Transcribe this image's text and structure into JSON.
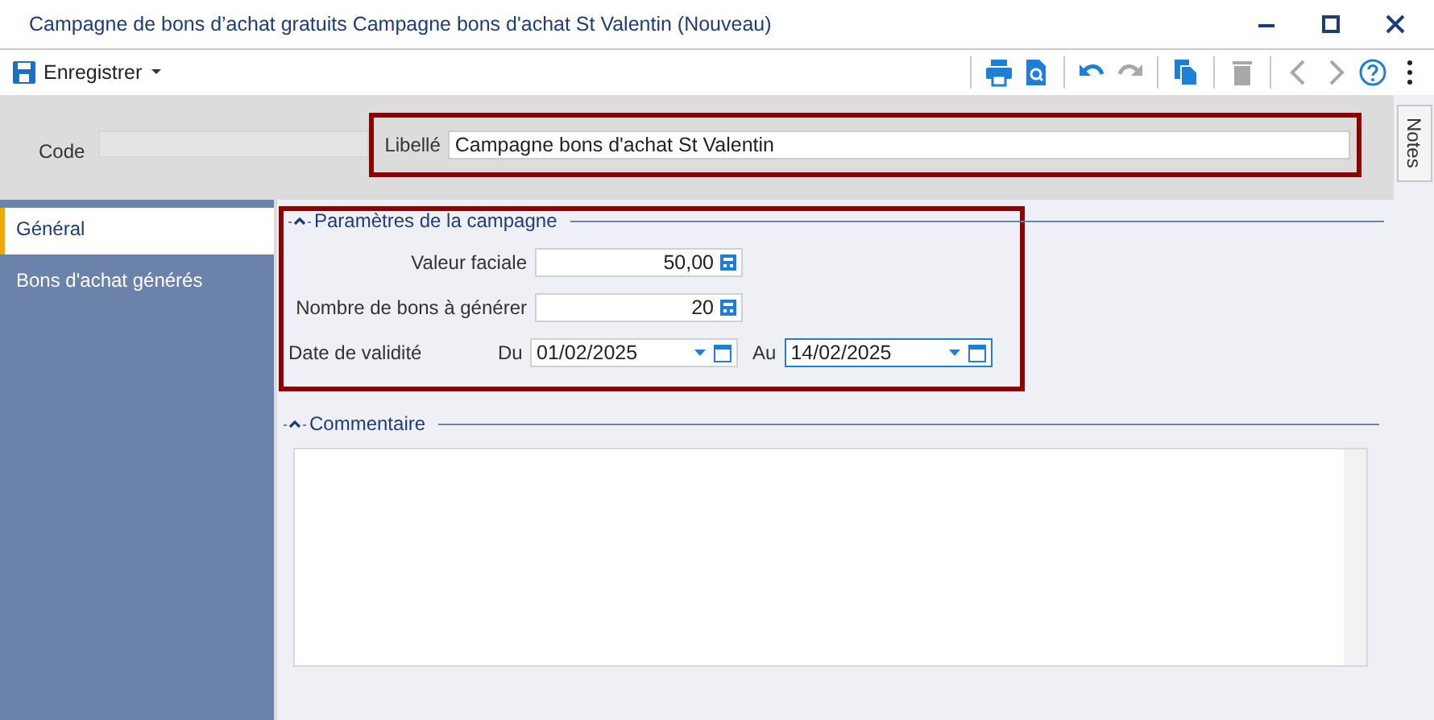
{
  "window": {
    "title": "Campagne de bons d’achat gratuits Campagne bons d'achat St Valentin (Nouveau)"
  },
  "toolbar": {
    "save_label": "Enregistrer",
    "tools": [
      {
        "kind": "print",
        "disabled": false,
        "separator_before": true
      },
      {
        "kind": "preview",
        "disabled": false,
        "separator_before": false
      },
      {
        "kind": "undo",
        "disabled": false,
        "separator_before": true
      },
      {
        "kind": "redo",
        "disabled": true,
        "separator_before": false
      },
      {
        "kind": "copy",
        "disabled": false,
        "separator_before": true
      },
      {
        "kind": "delete",
        "disabled": true,
        "separator_before": true
      },
      {
        "kind": "prev",
        "disabled": true,
        "separator_before": true
      },
      {
        "kind": "next",
        "disabled": true,
        "separator_before": false
      },
      {
        "kind": "help",
        "disabled": false,
        "separator_before": false
      },
      {
        "kind": "more",
        "disabled": false,
        "separator_before": false
      }
    ]
  },
  "header": {
    "code_label": "Code",
    "libelle_label": "Libellé",
    "libelle_value": "Campagne bons d'achat St Valentin"
  },
  "notes_tab": "Notes",
  "sidebar": {
    "items": [
      {
        "label": "Général",
        "selected": true
      },
      {
        "label": "Bons d'achat générés",
        "selected": false
      }
    ]
  },
  "parametres": {
    "legend": "Paramètres de la campagne",
    "valeur_label": "Valeur faciale",
    "valeur": "50,00",
    "nombre_label": "Nombre de bons à générer",
    "nombre": "20",
    "date_label": "Date de validité",
    "du_label": "Du",
    "du": "01/02/2025",
    "du_focused": false,
    "au_label": "Au",
    "au": "14/02/2025",
    "au_focused": true
  },
  "commentaire": {
    "legend": "Commentaire"
  }
}
